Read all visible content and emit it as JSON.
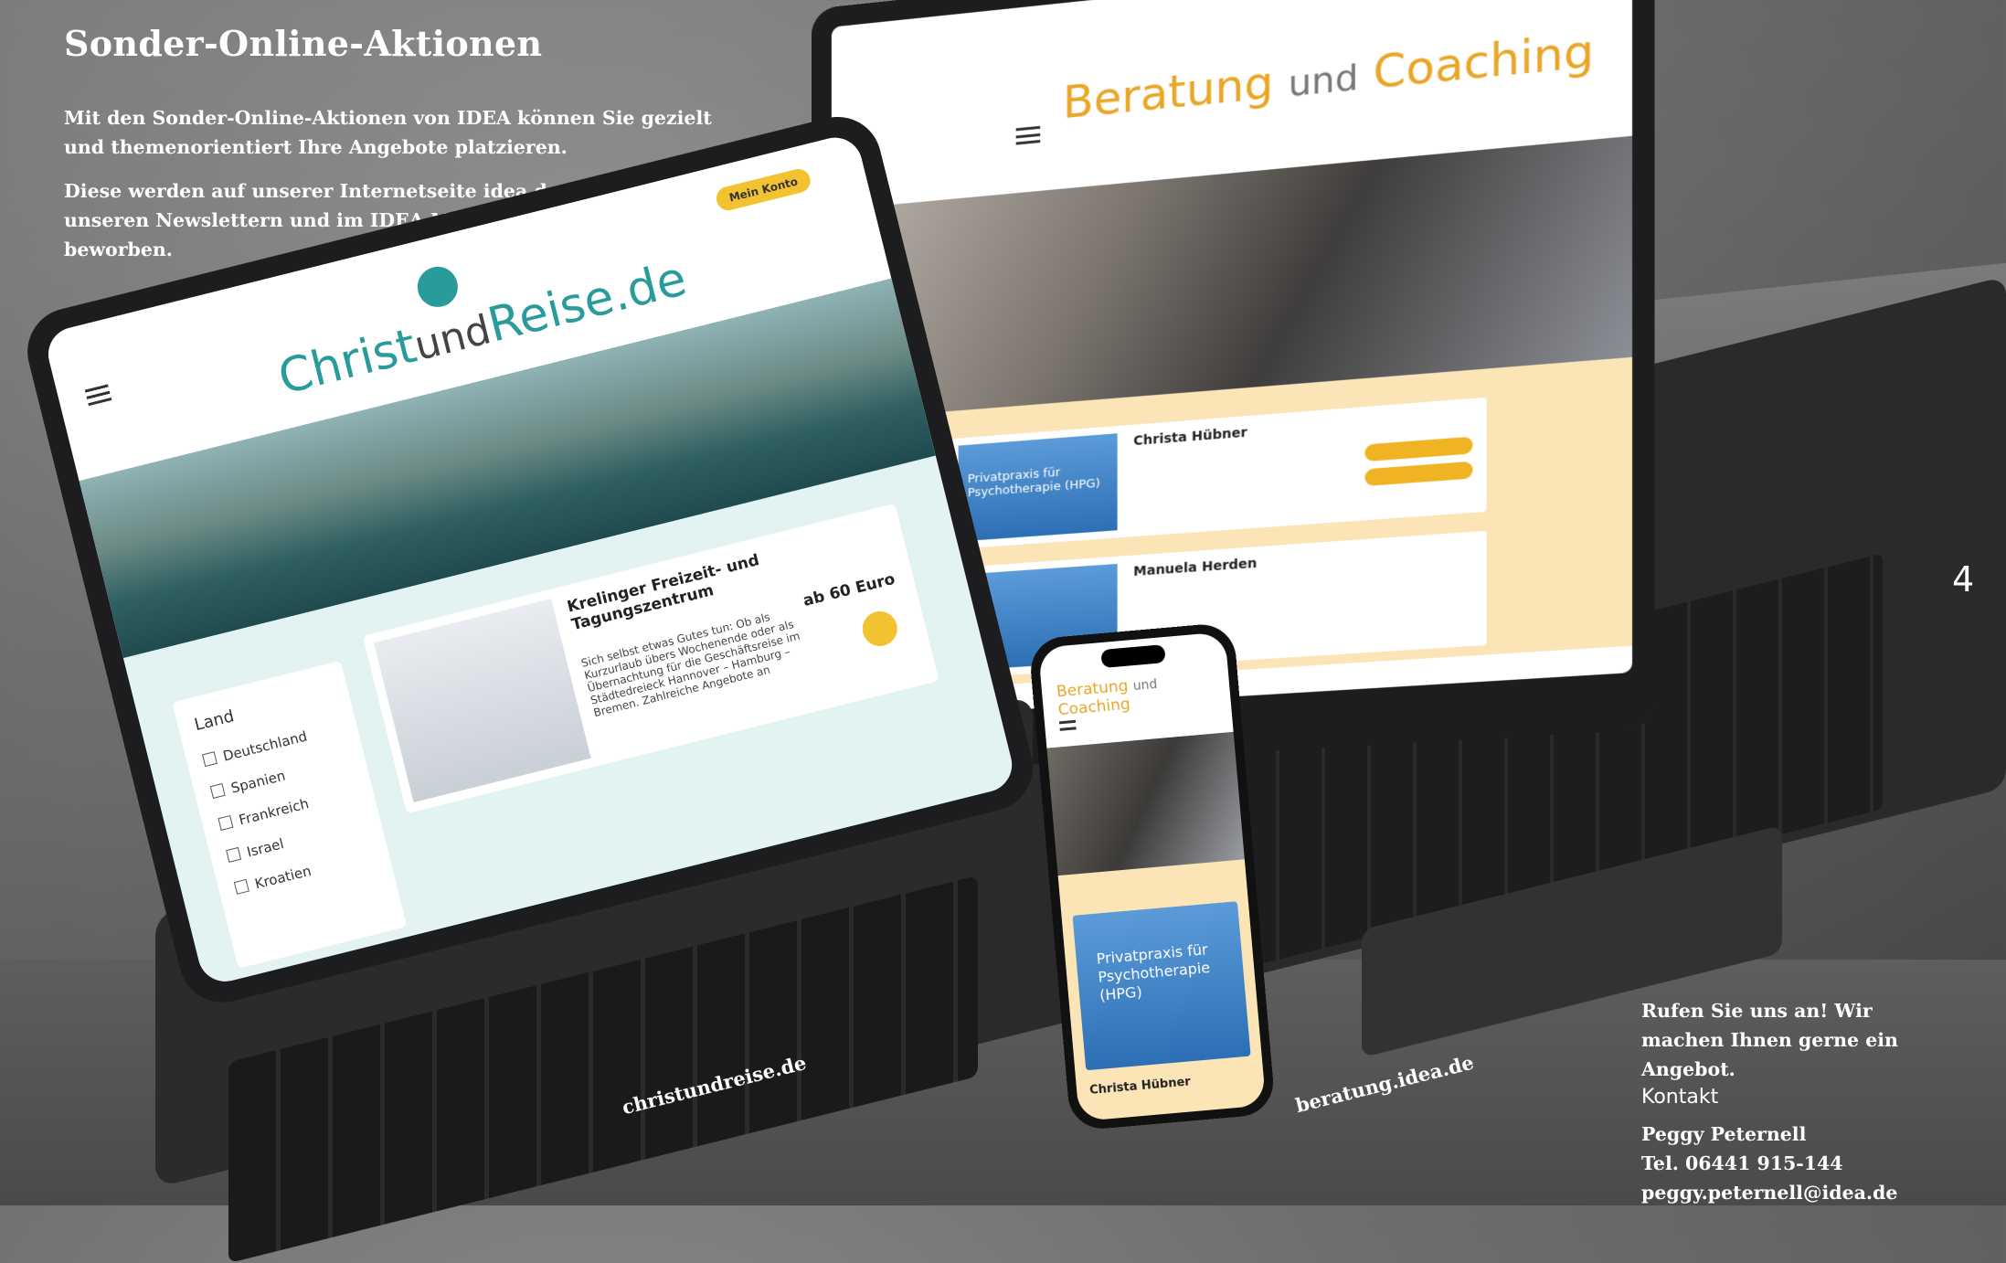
{
  "headline": "Sonder-Online-Aktionen",
  "intro": [
    "Mit den Sonder-Online-Aktionen von IDEA können Sie gezielt und themenorientiert Ihre Angebote platzieren.",
    "Diese werden auf unserer Internetseite idea.de sowie in unseren Newslettern und im IDEA Magazin zusätzlich beworben."
  ],
  "page_number": "4",
  "devices": {
    "laptop": {
      "site_title_a": "Beratung ",
      "site_title_und": "und",
      "site_title_b": " Coaching",
      "card_name": "Christa Hübner",
      "card_thumb": "Privatpraxis für Psychotherapie (HPG)",
      "card2_name": "Manuela Herden"
    },
    "tablet": {
      "logo_a": "Christ",
      "logo_und": "und",
      "logo_b": "Reise.de",
      "badge": "Mein Konto",
      "filter_title": "Land",
      "filter_options": [
        "Deutschland",
        "Spanien",
        "Frankreich",
        "Israel",
        "Kroatien"
      ],
      "card_title": "Krelinger Freizeit- und Tagungszentrum",
      "card_desc": "Sich selbst etwas Gutes tun: Ob als Kurzurlaub übers Wochenende oder als Übernachtung für die Geschäftsreise im Städtedreieck Hannover – Hamburg – Bremen. Zahlreiche Angebote an",
      "card_price": "ab 60 Euro"
    },
    "phone": {
      "site_title_a": "Beratung ",
      "site_title_und": "und",
      "site_title_b": " Coaching",
      "card_text": "Privatpraxis für Psychotherapie (HPG)",
      "card_name": "Christa Hübner"
    }
  },
  "urls": {
    "tablet": "christundreise.de",
    "laptop": "beratung.idea.de"
  },
  "contact": {
    "cta": "Rufen Sie uns an! Wir machen Ihnen gerne ein Angebot.",
    "heading": "Kontakt",
    "name": "Peggy Peternell",
    "tel": "Tel. 06441 915-144",
    "email": "peggy.peternell@idea.de"
  }
}
